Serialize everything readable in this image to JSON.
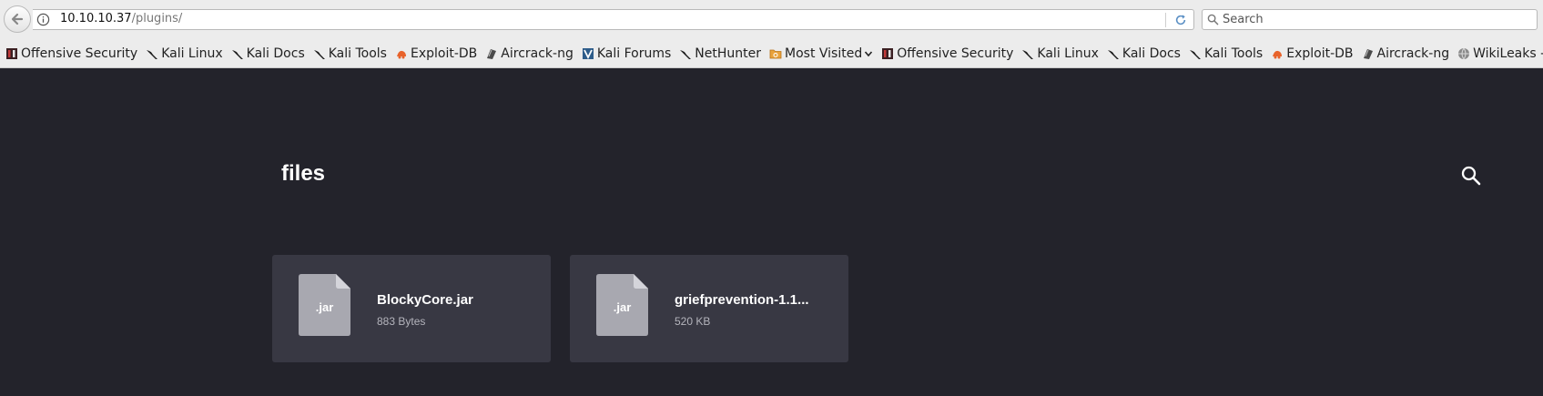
{
  "browser": {
    "url_host": "10.10.10.37",
    "url_path": "/plugins/",
    "search_placeholder": "Search"
  },
  "bookmarks": [
    {
      "label": "Offensive Security",
      "icon": "offsec-icon"
    },
    {
      "label": "Kali Linux",
      "icon": "kali-dragon-icon"
    },
    {
      "label": "Kali Docs",
      "icon": "kali-dragon-icon"
    },
    {
      "label": "Kali Tools",
      "icon": "kali-dragon-icon"
    },
    {
      "label": "Exploit-DB",
      "icon": "exploit-db-icon"
    },
    {
      "label": "Aircrack-ng",
      "icon": "aircrack-icon"
    },
    {
      "label": "Kali Forums",
      "icon": "kali-forums-icon"
    },
    {
      "label": "NetHunter",
      "icon": "kali-dragon-icon"
    },
    {
      "label": "Most Visited",
      "icon": "folder-icon"
    },
    {
      "label": "Offensive Security",
      "icon": "offsec-icon"
    },
    {
      "label": "Kali Linux",
      "icon": "kali-dragon-icon"
    },
    {
      "label": "Kali Docs",
      "icon": "kali-dragon-icon"
    },
    {
      "label": "Kali Tools",
      "icon": "kali-dragon-icon"
    },
    {
      "label": "Exploit-DB",
      "icon": "exploit-db-icon"
    },
    {
      "label": "Aircrack-ng",
      "icon": "aircrack-icon"
    },
    {
      "label": "WikiLeaks - /server/bea...",
      "icon": "globe-icon"
    }
  ],
  "page": {
    "title": "files",
    "files": [
      {
        "ext": ".jar",
        "name": "BlockyCore.jar",
        "size": "883 Bytes"
      },
      {
        "ext": ".jar",
        "name": "griefprevention-1.1...",
        "size": "520 KB"
      }
    ]
  },
  "colors": {
    "page_bg": "#23232b",
    "card_bg": "#383843",
    "file_icon": "#a8a8b0"
  }
}
